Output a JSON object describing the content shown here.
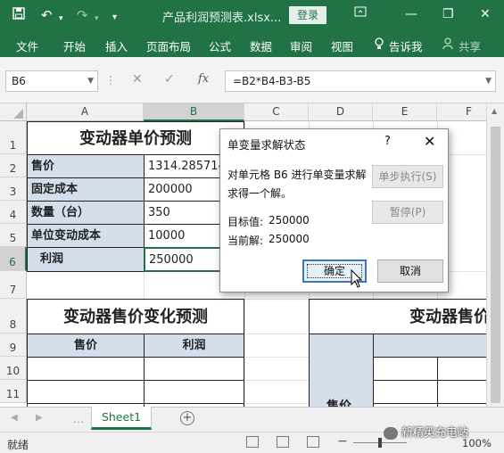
{
  "titlebar": {
    "save_icon": "save-icon",
    "undo_icon": "undo-icon",
    "redo_icon": "redo-icon",
    "customize_icon": "customize-qat-icon",
    "title": "产品利润预测表.xlsx...",
    "login": "登录",
    "ribbon_display_icon": "ribbon-display-icon",
    "minimize_icon": "minimize-icon",
    "restore_icon": "restore-icon",
    "close_icon": "close-icon"
  },
  "ribbon": {
    "tabs": [
      "文件",
      "开始",
      "插入",
      "页面布局",
      "公式",
      "数据",
      "审阅",
      "视图"
    ],
    "tellme": "告诉我",
    "share": "共享"
  },
  "formula_bar": {
    "name_box": "B6",
    "fx": "fx",
    "formula": "=B2*B4-B3-B5"
  },
  "grid": {
    "columns": [
      "A",
      "B",
      "C",
      "D",
      "E",
      "F"
    ],
    "rows": [
      "1",
      "2",
      "3",
      "4",
      "5",
      "6",
      "7",
      "8",
      "9",
      "10",
      "11"
    ],
    "title1": "变动器单价预测",
    "labels": [
      "售价",
      "固定成本",
      "数量（台）",
      "单位变动成本",
      "利润"
    ],
    "values": [
      "1314.285714",
      "200000",
      "350",
      "10000",
      "250000"
    ],
    "title2": "变动器售价变化预测",
    "table2_headers": [
      "售价",
      "利润"
    ],
    "title3": "变动器售价",
    "partial_label": "售价"
  },
  "sheets": {
    "active": "Sheet1",
    "add_icon": "add-sheet-icon"
  },
  "statusbar": {
    "ready": "就绪",
    "zoom": "100%",
    "zoom_level": 1.0
  },
  "watermark": "新精英充电站",
  "dialog": {
    "title": "单变量求解状态",
    "help": "?",
    "message_line1": "对单元格 B6 进行单变量求解",
    "message_line2": "求得一个解。",
    "target_label": "目标值:",
    "target_value": "250000",
    "current_label": "当前解:",
    "current_value": "250000",
    "step_button": "单步执行(S)",
    "pause_button": "暂停(P)",
    "ok_button": "确定",
    "cancel_button": "取消"
  }
}
